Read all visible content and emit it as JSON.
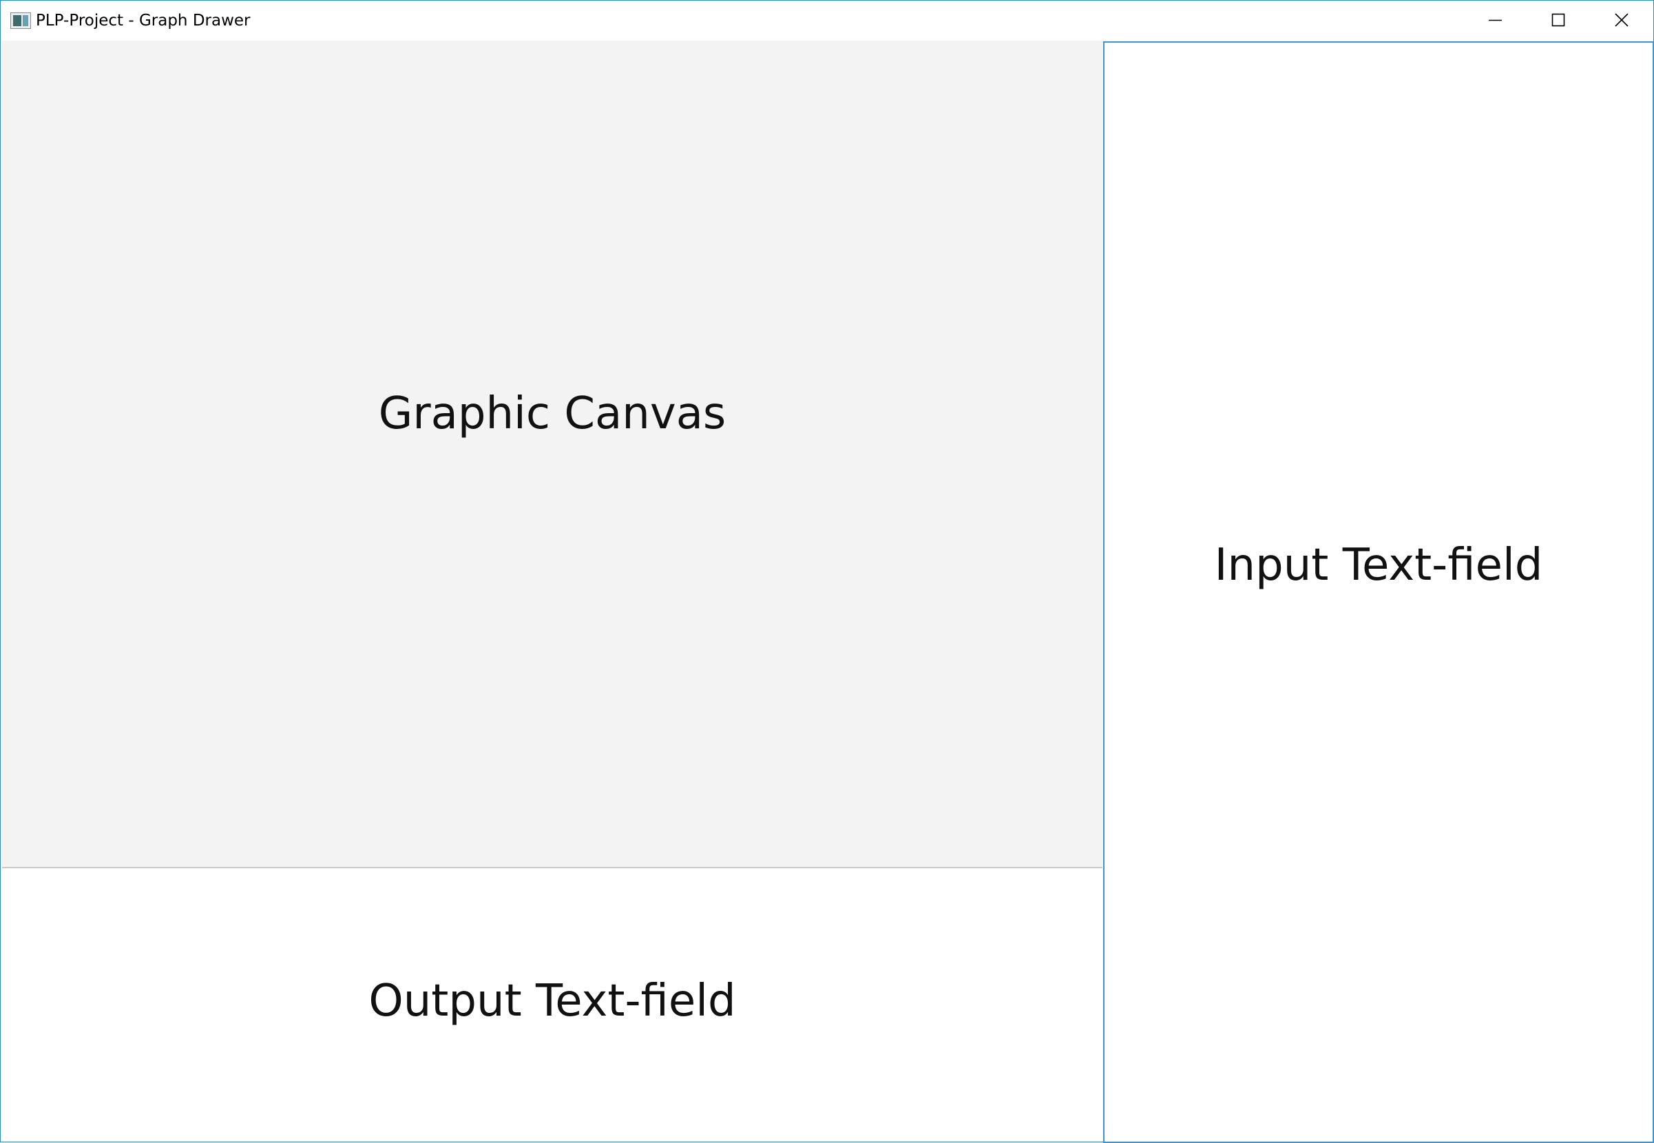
{
  "window": {
    "title": "PLP-Project - Graph Drawer",
    "app_icon": "window-app-icon",
    "controls": {
      "minimize_icon": "minimize-icon",
      "maximize_icon": "maximize-icon",
      "close_icon": "close-icon"
    },
    "accent_color": "#2b8ac9"
  },
  "canvas": {
    "label": "Graphic Canvas",
    "background": "#f3f3f3"
  },
  "output": {
    "label": "Output Text-field"
  },
  "input": {
    "label": "Input Text-field",
    "border_color": "#3a95d0"
  }
}
